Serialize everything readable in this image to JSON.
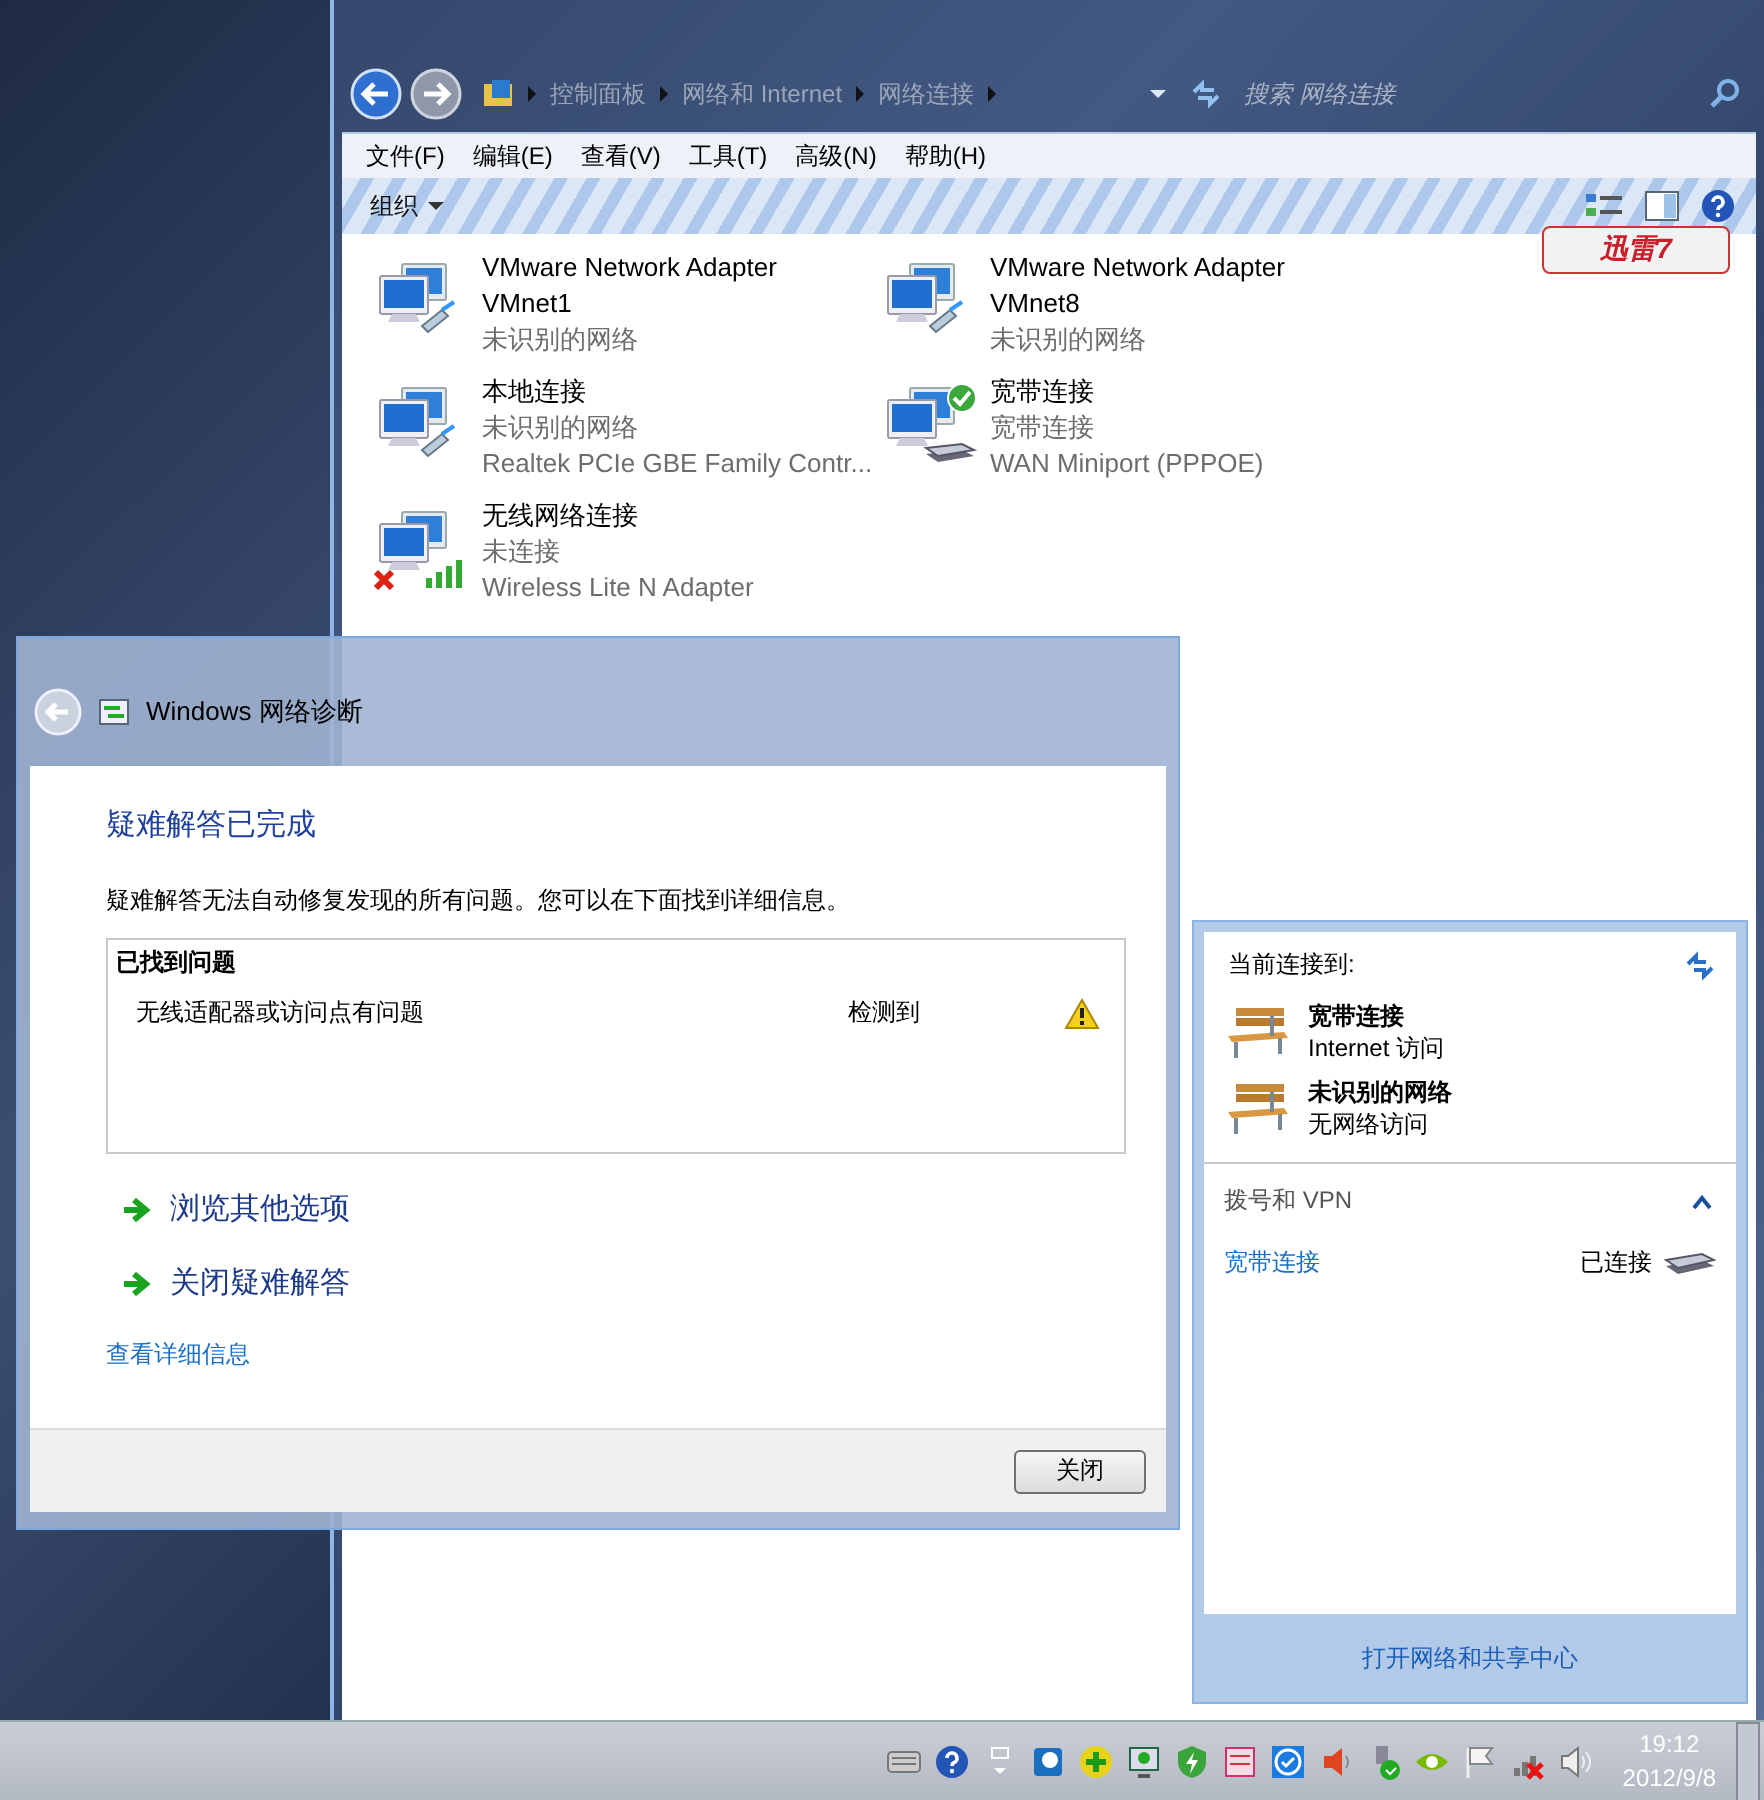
{
  "explorer": {
    "breadcrumb": [
      "控制面板",
      "网络和 Internet",
      "网络连接"
    ],
    "search": {
      "placeholder": "搜索 网络连接"
    },
    "menu": [
      "文件(F)",
      "编辑(E)",
      "查看(V)",
      "工具(T)",
      "高级(N)",
      "帮助(H)"
    ],
    "toolbar": {
      "organize": "组织",
      "badge": "迅雷7"
    },
    "adapters": [
      {
        "name": "VMware Network Adapter VMnet1",
        "status": "未识别的网络",
        "kind": "cable"
      },
      {
        "name": "VMware Network Adapter VMnet8",
        "status": "未识别的网络",
        "kind": "cable"
      },
      {
        "name": "本地连接",
        "status": "未识别的网络",
        "device": "Realtek PCIe GBE Family Contr...",
        "kind": "cable"
      },
      {
        "name": "宽带连接",
        "status": "宽带连接",
        "device": "WAN Miniport (PPPOE)",
        "kind": "modem",
        "connected": true
      },
      {
        "name": "无线网络连接",
        "status": "未连接",
        "device": "Wireless Lite N Adapter",
        "kind": "wireless",
        "disconnected": true
      }
    ]
  },
  "diagnostics": {
    "title": "Windows 网络诊断",
    "heading": "疑难解答已完成",
    "message": "疑难解答无法自动修复发现的所有问题。您可以在下面找到详细信息。",
    "problems": {
      "title": "已找到问题",
      "rows": [
        {
          "text": "无线适配器或访问点有问题",
          "status": "检测到"
        }
      ]
    },
    "options": [
      "浏览其他选项",
      "关闭疑难解答"
    ],
    "details_link": "查看详细信息",
    "button": "关闭"
  },
  "flyout": {
    "header": "当前连接到:",
    "networks": [
      {
        "name": "宽带连接",
        "access": "Internet 访问"
      },
      {
        "name": "未识别的网络",
        "access": "无网络访问"
      }
    ],
    "section": {
      "title": "拨号和 VPN",
      "expanded": true,
      "items": [
        {
          "name": "宽带连接",
          "status": "已连接"
        }
      ]
    },
    "footer_link": "打开网络和共享中心"
  },
  "taskbar": {
    "time": "19:12",
    "date": "2012/9/8"
  }
}
